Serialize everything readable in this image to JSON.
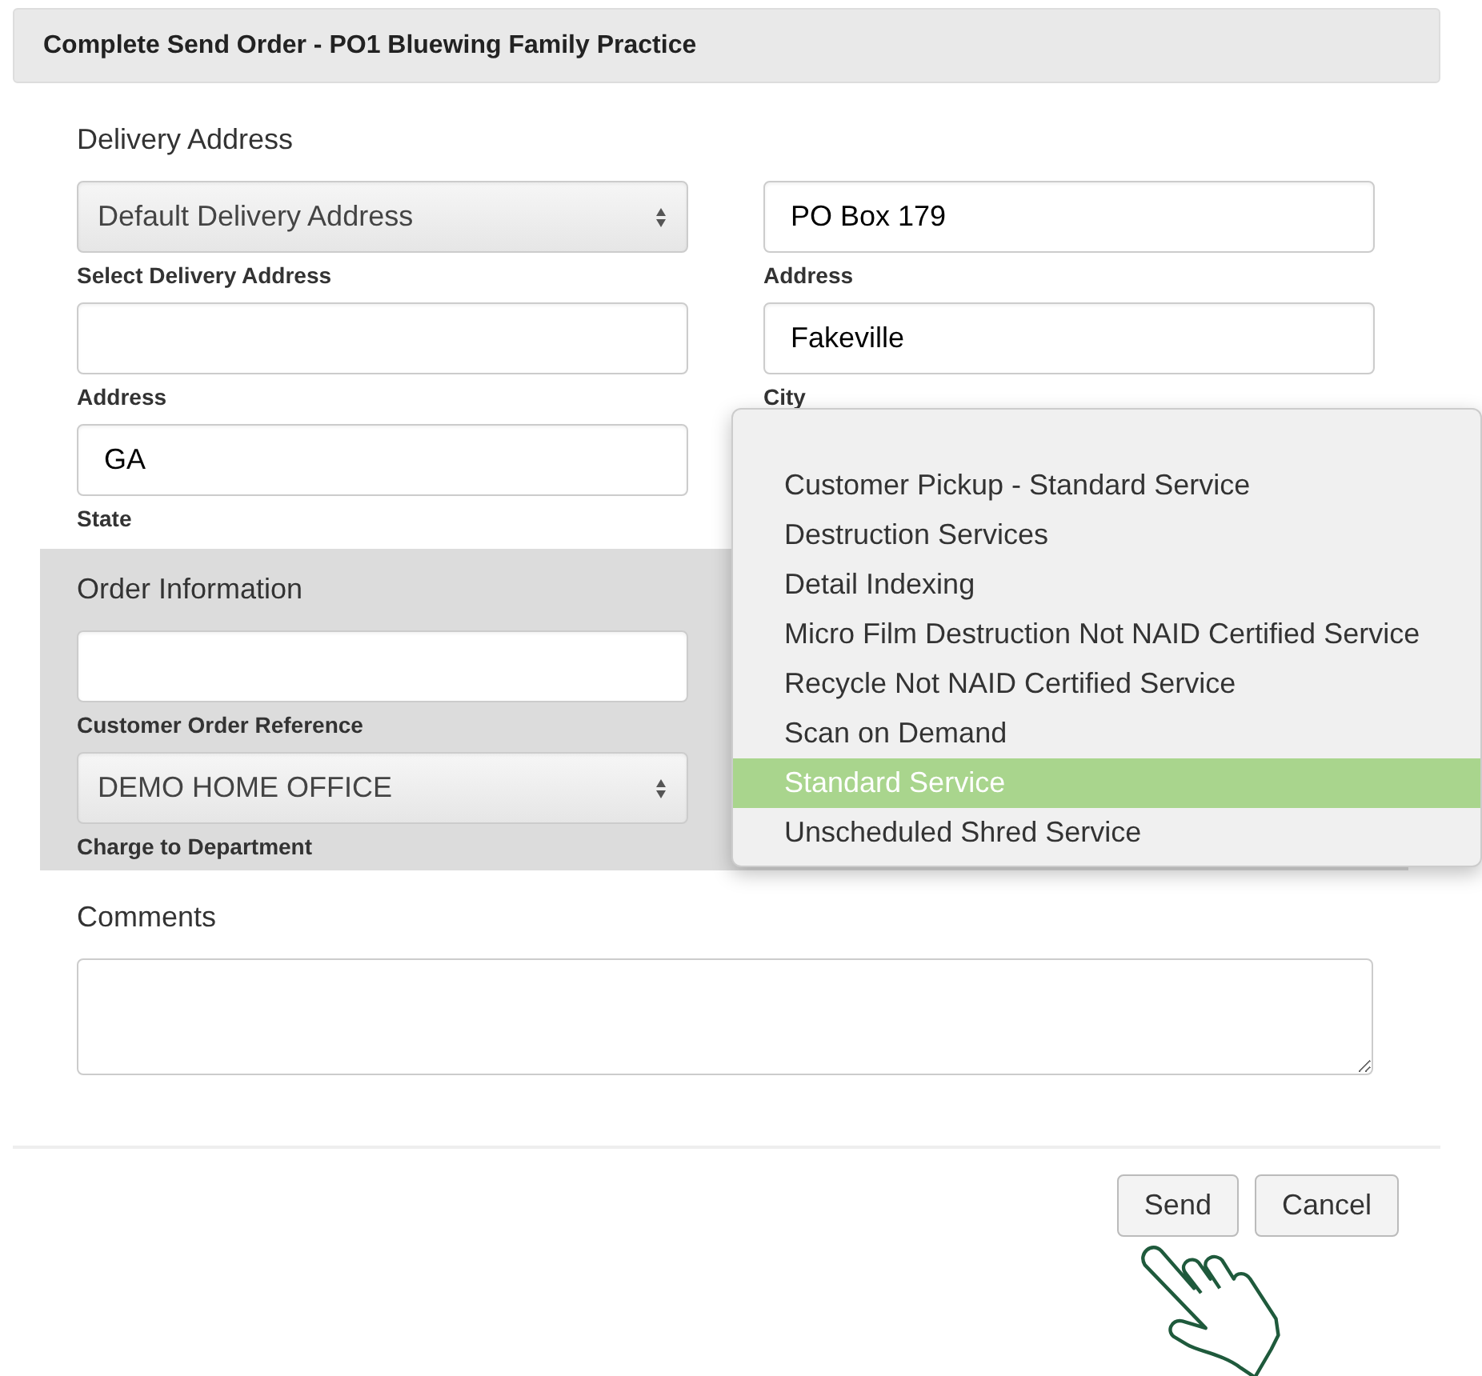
{
  "dialog": {
    "title": "Complete Send Order - PO1 Bluewing Family Practice"
  },
  "delivery": {
    "heading": "Delivery Address",
    "fields": [
      {
        "kind": "select",
        "value": "Default Delivery Address",
        "label": "Select Delivery Address"
      },
      {
        "kind": "text",
        "label": "Address"
      },
      {
        "kind": "text",
        "value": "GA",
        "label": "State"
      },
      {
        "kind": "text",
        "value": "PO Box 179",
        "label": "Address"
      },
      {
        "kind": "text",
        "value": "Fakeville",
        "label": "City"
      }
    ]
  },
  "order_information": {
    "heading": "Order Information",
    "fields": [
      {
        "kind": "text",
        "label": "Customer Order Reference"
      },
      {
        "kind": "select",
        "value": "DEMO HOME OFFICE",
        "label": "Charge to Department"
      }
    ]
  },
  "service_menu": {
    "options": [
      {
        "label": "Customer Pickup - Standard Service",
        "selected": false
      },
      {
        "label": "Destruction Services",
        "selected": false
      },
      {
        "label": "Detail Indexing",
        "selected": false
      },
      {
        "label": "Micro Film Destruction Not NAID Certified Service",
        "selected": false
      },
      {
        "label": "Recycle Not NAID Certified Service",
        "selected": false
      },
      {
        "label": "Scan on Demand",
        "selected": false
      },
      {
        "label": "Standard Service",
        "selected": true
      },
      {
        "label": "Unscheduled Shred Service",
        "selected": false
      }
    ]
  },
  "comments": {
    "heading": "Comments"
  },
  "buttons": [
    {
      "label": "Send"
    },
    {
      "label": "Cancel"
    }
  ]
}
